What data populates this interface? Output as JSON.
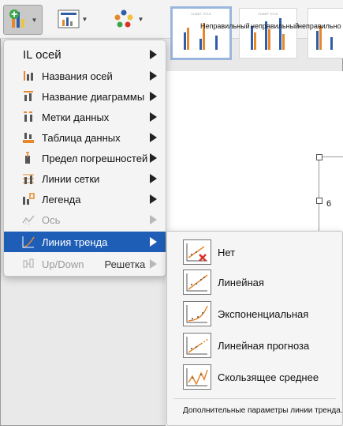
{
  "ribbon": {
    "add_element_icon": "add-chart-element-icon",
    "quick_layout_icon": "quick-layout-icon",
    "change_colors_icon": "change-colors-icon",
    "style_thumbs": [
      "CHART TITLE",
      "CHART TITLE"
    ],
    "style_captions": [
      "Неправильный",
      "неправильный",
      "неправильно"
    ]
  },
  "menu": {
    "items": [
      {
        "label": "IL осей",
        "icon": "axes-icon",
        "has_submenu": true,
        "state": "normal"
      },
      {
        "label": "Названия осей",
        "icon": "axis-titles-icon",
        "has_submenu": true,
        "state": "normal"
      },
      {
        "label": "Название диаграммы",
        "icon": "chart-title-icon",
        "has_submenu": true,
        "state": "normal"
      },
      {
        "label": "Метки данных",
        "icon": "data-labels-icon",
        "has_submenu": true,
        "state": "normal"
      },
      {
        "label": "Таблица данных",
        "icon": "data-table-icon",
        "has_submenu": true,
        "state": "normal"
      },
      {
        "label": "Предел погрешностей",
        "icon": "error-bars-icon",
        "has_submenu": true,
        "state": "normal"
      },
      {
        "label": "Линии сетки",
        "icon": "gridlines-icon",
        "has_submenu": true,
        "state": "normal"
      },
      {
        "label": "Легенда",
        "icon": "legend-icon",
        "has_submenu": true,
        "state": "normal"
      },
      {
        "label": "Ось",
        "icon": "lines-icon",
        "has_submenu": true,
        "state": "disabled"
      },
      {
        "label": "Линия тренда",
        "icon": "trendline-icon",
        "has_submenu": true,
        "state": "active"
      },
      {
        "label": "Up/Down",
        "label2": "Решетка",
        "icon": "up-down-bars-icon",
        "has_submenu": true,
        "state": "disabled"
      }
    ]
  },
  "submenu": {
    "items": [
      {
        "label": "Нет",
        "icon": "trendline-none-icon"
      },
      {
        "label": "Линейная",
        "icon": "trendline-linear-icon"
      },
      {
        "label": "Экспоненциальная",
        "icon": "trendline-exponential-icon"
      },
      {
        "label": "Линейная прогноза",
        "icon": "trendline-linear-forecast-icon"
      },
      {
        "label": "Скользящее среднее",
        "icon": "trendline-moving-average-icon"
      }
    ],
    "footer": "Дополнительные параметры линии тренда..."
  },
  "document": {
    "axis_number": "6"
  },
  "colors": {
    "active_item": "#1f5eb7",
    "icon_orange": "#e7872c",
    "icon_blue": "#2f5ea8",
    "delete_red": "#d8342b"
  }
}
